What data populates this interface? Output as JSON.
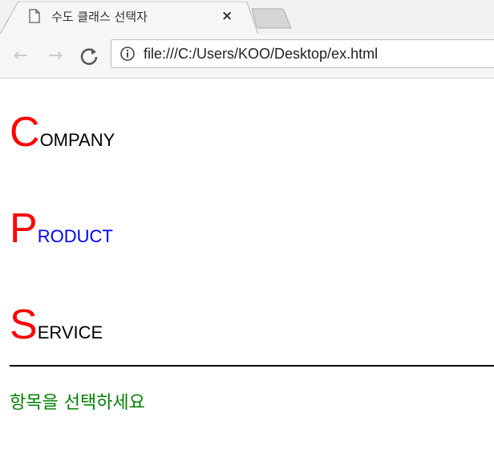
{
  "browser": {
    "tab_title": "수도 클래스 선택자",
    "tab_close_glyph": "×",
    "url": "file:///C:/Users/KOO/Desktop/ex.html",
    "back_glyph": "←",
    "forward_glyph": "→",
    "reload_glyph": "↻"
  },
  "page": {
    "items": [
      {
        "initial": "C",
        "rest": "OMPANY",
        "initial_color": "#ff0000",
        "rest_color": "#000000"
      },
      {
        "initial": "P",
        "rest": "RODUCT",
        "initial_color": "#ff0000",
        "rest_color": "#0000ff"
      },
      {
        "initial": "S",
        "rest": "ERVICE",
        "initial_color": "#ff0000",
        "rest_color": "#000000"
      }
    ],
    "status_text": "항목을 선택하세요",
    "status_color": "#008000"
  }
}
